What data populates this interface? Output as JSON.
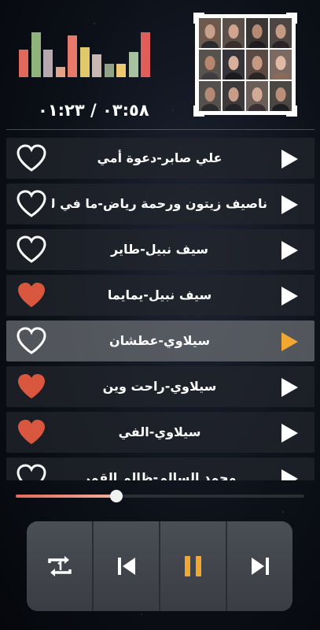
{
  "colors": {
    "accent": "#f0a830",
    "heart_filled": "#d9573f",
    "heart_outline": "#ffffff",
    "seek_fill": "#e46a5c"
  },
  "equalizer": {
    "bars": [
      {
        "level": 0.6,
        "color": "#e0695c"
      },
      {
        "level": 0.98,
        "color": "#8fb37a"
      },
      {
        "level": 0.6,
        "color": "#b9a7b0"
      },
      {
        "level": 0.22,
        "color": "#e3a58a"
      },
      {
        "level": 0.92,
        "color": "#e87a6b"
      },
      {
        "level": 0.66,
        "color": "#e0c96a"
      },
      {
        "level": 0.5,
        "color": "#c7b7b0"
      },
      {
        "level": 0.3,
        "color": "#8ea483"
      },
      {
        "level": 0.3,
        "color": "#f0c870"
      },
      {
        "level": 0.56,
        "color": "#a7c2a0"
      },
      {
        "level": 0.98,
        "color": "#e05e5a"
      }
    ]
  },
  "artwork": {
    "tiles": [
      {
        "face": "#c9a08c",
        "bg": "#6d5a4c",
        "body": "#2b2b2f"
      },
      {
        "face": "#d1a48e",
        "bg": "#5b4f49",
        "body": "#3a2f2b"
      },
      {
        "face": "#b58a73",
        "bg": "#3b3636",
        "body": "#1e1e22"
      },
      {
        "face": "#c69b83",
        "bg": "#4d4644",
        "body": "#2a2426"
      },
      {
        "face": "#b7866c",
        "bg": "#57524e",
        "body": "#3f3d3e"
      },
      {
        "face": "#d8b09c",
        "bg": "#37333a",
        "body": "#1b1b1f"
      },
      {
        "face": "#c69a82",
        "bg": "#5a4a43",
        "body": "#2b2624"
      },
      {
        "face": "#e0b9a4",
        "bg": "#7c6a62",
        "body": "#8a6a5a"
      },
      {
        "face": "#b48a74",
        "bg": "#53504e",
        "body": "#2c2b2d"
      },
      {
        "face": "#c79d87",
        "bg": "#3e3a3c",
        "body": "#23242a"
      },
      {
        "face": "#d2aa95",
        "bg": "#6a5e58",
        "body": "#3b3035"
      },
      {
        "face": "#ba8e77",
        "bg": "#4a4643",
        "body": "#1e1f22"
      }
    ]
  },
  "player": {
    "time": "٠٣:٥٨ / ٠١:٢٣",
    "progress": 0.35
  },
  "playlist": [
    {
      "title": "علي صابر-دعوة أمي",
      "favorite": false,
      "active": false
    },
    {
      "title": "ناصيف زيتون ورحمة رياض-ما في ليل",
      "favorite": false,
      "active": false
    },
    {
      "title": "سيف نبيل-طاير",
      "favorite": false,
      "active": false
    },
    {
      "title": "سيف نبيل-يمايما",
      "favorite": true,
      "active": false
    },
    {
      "title": "سيلاوي-عطشان",
      "favorite": false,
      "active": true
    },
    {
      "title": "سيلاوي-راحت وين",
      "favorite": true,
      "active": false
    },
    {
      "title": "سيلاوي-الفي",
      "favorite": true,
      "active": false
    },
    {
      "title": "محمد السالم-ظالم القمر",
      "favorite": false,
      "active": false
    }
  ],
  "controls": {
    "repeat_icon": "repeat-one-icon",
    "prev_icon": "skip-previous-icon",
    "pause_icon": "pause-icon",
    "next_icon": "skip-next-icon"
  }
}
